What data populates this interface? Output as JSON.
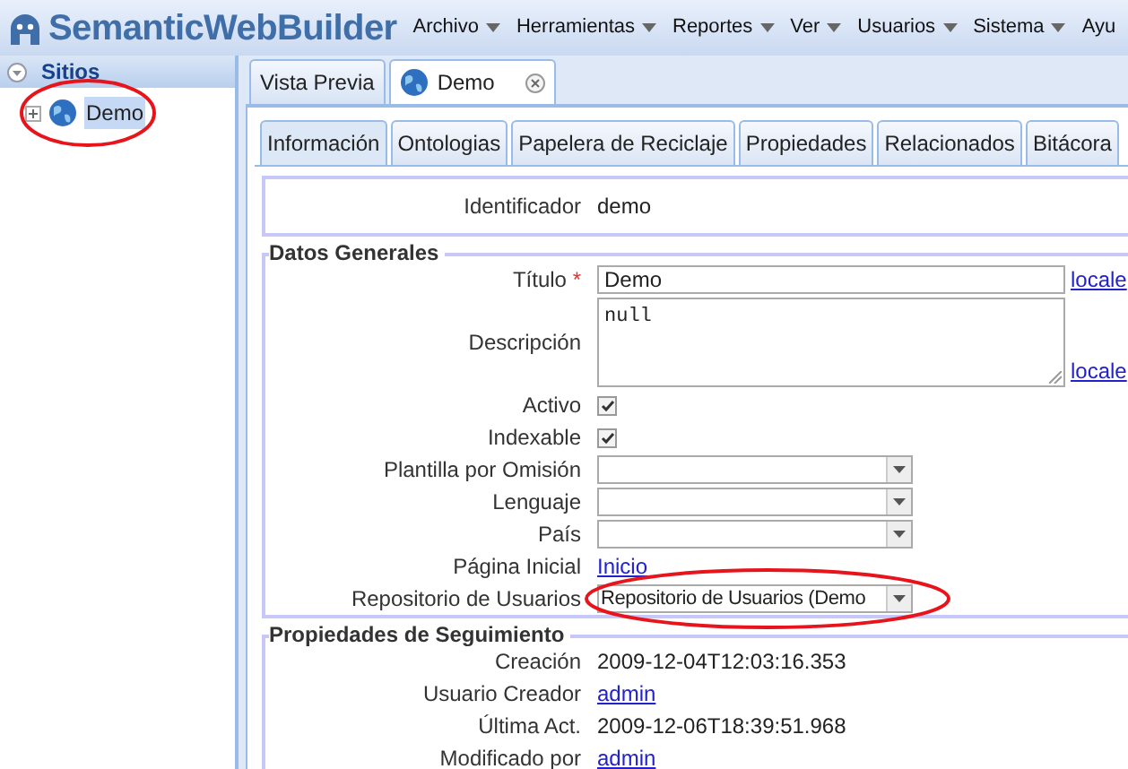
{
  "app": {
    "logo": "SemanticWebBuilder"
  },
  "menu": [
    {
      "label": "Archivo",
      "caret": true
    },
    {
      "label": "Herramientas",
      "caret": true
    },
    {
      "label": "Reportes",
      "caret": true
    },
    {
      "label": "Ver",
      "caret": true
    },
    {
      "label": "Usuarios",
      "caret": true
    },
    {
      "label": "Sistema",
      "caret": true
    },
    {
      "label": "Ayu",
      "caret": false
    }
  ],
  "sidebar": {
    "title": "Sitios",
    "tree": [
      {
        "label": "Demo",
        "expanded": false,
        "selected": true,
        "highlight": true
      }
    ]
  },
  "main_tabs": [
    {
      "label": "Vista Previa",
      "kind": "plain",
      "selected": false,
      "closable": false
    },
    {
      "label": "Demo",
      "kind": "site",
      "selected": true,
      "closable": true
    }
  ],
  "sub_tabs": [
    {
      "label": "Información",
      "selected": true
    },
    {
      "label": "Ontologias",
      "selected": false
    },
    {
      "label": "Papelera de Reciclaje",
      "selected": false
    },
    {
      "label": "Propiedades",
      "selected": false
    },
    {
      "label": "Relacionados",
      "selected": false
    },
    {
      "label": "Bitácora",
      "selected": false
    }
  ],
  "header_fields": [
    {
      "kind": "plain",
      "label": "Identificador",
      "value": "demo"
    }
  ],
  "sections": [
    {
      "title": "Datos Generales",
      "fields": [
        {
          "kind": "text",
          "label": "Título",
          "required_mark": "*",
          "value": "Demo",
          "locale": "locale"
        },
        {
          "kind": "textarea",
          "label": "Descripción",
          "value": "null",
          "locale": "locale"
        },
        {
          "kind": "checkbox",
          "label": "Activo",
          "checked": true
        },
        {
          "kind": "checkbox",
          "label": "Indexable",
          "checked": true
        },
        {
          "kind": "select",
          "label": "Plantilla por Omisión"
        },
        {
          "kind": "select",
          "label": "Lenguaje"
        },
        {
          "kind": "select",
          "label": "País"
        },
        {
          "kind": "link",
          "label": "Página Inicial",
          "value": "Inicio"
        },
        {
          "kind": "select",
          "label": "Repositorio de Usuarios",
          "value": "Repositorio de Usuarios (Demo",
          "highlight": true
        }
      ]
    },
    {
      "title": "Propiedades de Seguimiento",
      "fields": [
        {
          "kind": "plain",
          "label": "Creación",
          "value": "2009-12-04T12:03:16.353"
        },
        {
          "kind": "link",
          "label": "Usuario Creador",
          "value": "admin"
        },
        {
          "kind": "plain",
          "label": "Última Act.",
          "value": "2009-12-06T18:39:51.968"
        },
        {
          "kind": "link",
          "label": "Modificado por",
          "value": "admin"
        }
      ]
    }
  ]
}
